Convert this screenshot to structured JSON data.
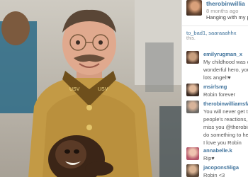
{
  "colors": {
    "link": "#3f729b",
    "muted": "#999999",
    "text": "#555555"
  },
  "photo": {
    "icon": "photo-of-man-in-uniform-with-monkey"
  },
  "post": {
    "username": "therobinwillia",
    "posted": "8 months ago",
    "caption": "Hanging with my p"
  },
  "likes": {
    "users": "to_bad1, saaraaahhx",
    "more": "this."
  },
  "comments": [
    {
      "user": "emilyrugman_x",
      "lines": [
        "My childhood was c",
        "wonderful hero, you",
        "lots angel!♥"
      ]
    },
    {
      "user": "msirlsmg",
      "lines": [
        "Robin forever"
      ]
    },
    {
      "user": "therobinwilliamsfan",
      "lines": [
        "You will never get to",
        "people's reactions, a",
        "miss you @therobin",
        "do something to hel",
        "I love you Robin"
      ]
    },
    {
      "user": "annabelle.k",
      "lines": [
        "Rip♥"
      ]
    },
    {
      "user": "jacopons5liga",
      "lines": [
        "Robin <3"
      ]
    }
  ]
}
